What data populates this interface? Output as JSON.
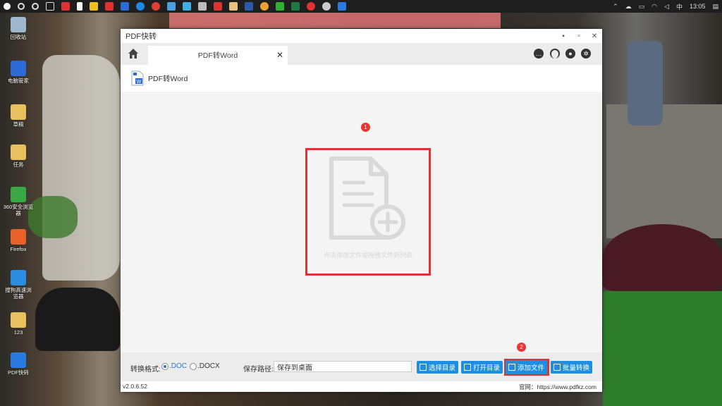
{
  "taskbar": {
    "tray": {
      "ime": "中",
      "clock": "13:05"
    }
  },
  "desktop_icons": [
    {
      "label": "回收站",
      "color": "#9fb8d0"
    },
    {
      "label": "电脑管家",
      "color": "#2a6bd8"
    },
    {
      "label": "草稿",
      "color": "#e8c060"
    },
    {
      "label": "任务",
      "color": "#e8c060"
    },
    {
      "label": "360安全浏览器",
      "color": "#3aa845"
    },
    {
      "label": "Firefox",
      "color": "#e8602a"
    },
    {
      "label": "搜狗高速浏览器",
      "color": "#2a8de0"
    },
    {
      "label": "123",
      "color": "#e8c060"
    },
    {
      "label": "PDF快转",
      "color": "#2a7ae0"
    }
  ],
  "window": {
    "title": "PDF快转",
    "controls": {
      "minimize": "▪",
      "maximize": "▫",
      "close": "✕"
    }
  },
  "tab": {
    "label": "PDF转Word",
    "close": "✕"
  },
  "subhead": {
    "title": "PDF转Word"
  },
  "dropzone": {
    "hint": "点击添加文件或拖拽文件到列表"
  },
  "steps": {
    "one": "1",
    "two": "2"
  },
  "bottom": {
    "format_label": "转换格式:",
    "opt_doc": ".DOC",
    "opt_docx": ".DOCX",
    "path_label": "保存路径:",
    "path_value": "保存到桌面",
    "btn_select_dir": "选择目录",
    "btn_open_dir": "打开目录",
    "btn_add_file": "添加文件",
    "btn_batch": "批量转换"
  },
  "status": {
    "version": "v2.0.6.52",
    "website": "官网：https://www.pdfkz.com"
  },
  "colors": {
    "accent": "#1e8fe0",
    "highlight": "#dd3333"
  }
}
